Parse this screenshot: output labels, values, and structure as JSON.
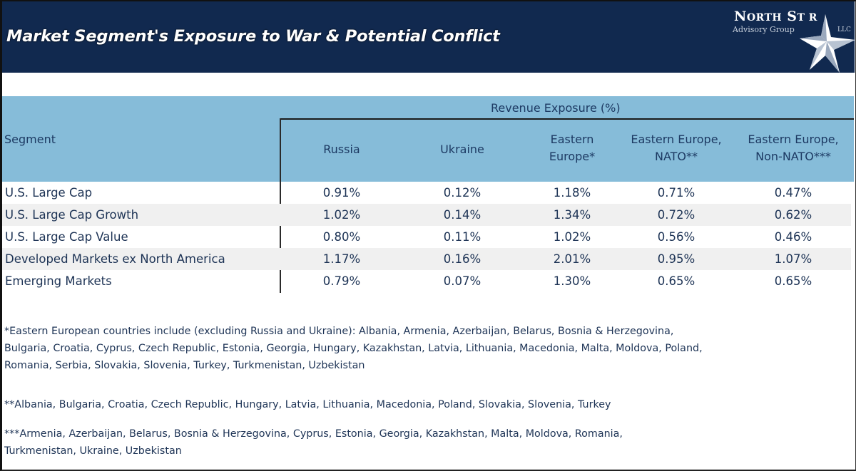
{
  "banner": {
    "title": "Market Segment's Exposure to War & Potential Conflict",
    "logo": {
      "name_first": "N",
      "name_first_rest": "ORTH",
      "name_second": "S",
      "name_second_rest": "T R",
      "subtitle": "Advisory Group",
      "suffix": "LLC",
      "icon": "star-icon"
    }
  },
  "table": {
    "group_header": "Revenue Exposure (%)",
    "segment_header": "Segment",
    "columns": [
      {
        "line1": "Russia",
        "line2": ""
      },
      {
        "line1": "Ukraine",
        "line2": ""
      },
      {
        "line1": "Eastern",
        "line2": "Europe*"
      },
      {
        "line1": "Eastern Europe,",
        "line2": "NATO**"
      },
      {
        "line1": "Eastern Europe,",
        "line2": "Non-NATO***"
      }
    ],
    "rows": [
      {
        "segment": "U.S. Large Cap",
        "values": [
          "0.91%",
          "0.12%",
          "1.18%",
          "0.71%",
          "0.47%"
        ]
      },
      {
        "segment": "U.S. Large Cap Growth",
        "values": [
          "1.02%",
          "0.14%",
          "1.34%",
          "0.72%",
          "0.62%"
        ]
      },
      {
        "segment": "U.S. Large Cap Value",
        "values": [
          "0.80%",
          "0.11%",
          "1.02%",
          "0.56%",
          "0.46%"
        ]
      },
      {
        "segment": "Developed Markets ex North America",
        "values": [
          "1.17%",
          "0.16%",
          "2.01%",
          "0.95%",
          "1.07%"
        ]
      },
      {
        "segment": "Emerging Markets",
        "values": [
          "0.79%",
          "0.07%",
          "1.30%",
          "0.65%",
          "0.65%"
        ]
      }
    ]
  },
  "footnotes": {
    "note1": "*Eastern European countries include (excluding Russia and Ukraine): Albania, Armenia, Azerbaijan, Belarus, Bosnia & Herzegovina,\nBulgaria, Croatia, Cyprus, Czech Republic, Estonia, Georgia, Hungary, Kazakhstan, Latvia, Lithuania, Macedonia, Malta, Moldova, Poland,\nRomania, Serbia, Slovakia, Slovenia, Turkey, Turkmenistan, Uzbekistan",
    "note2": "**Albania, Bulgaria, Croatia, Czech Republic, Hungary, Latvia, Lithuania, Macedonia, Poland, Slovakia, Slovenia, Turkey",
    "note3": "***Armenia, Azerbaijan, Belarus, Bosnia & Herzegovina, Cyprus, Estonia, Georgia, Kazakhstan, Malta, Moldova, Romania,\n    Turkmenistan, Ukraine, Uzbekistan"
  },
  "colors": {
    "banner": "#11294f",
    "header_fill": "#86bcd9",
    "text": "#1d3355",
    "alt_row": "#f0f0f0"
  }
}
